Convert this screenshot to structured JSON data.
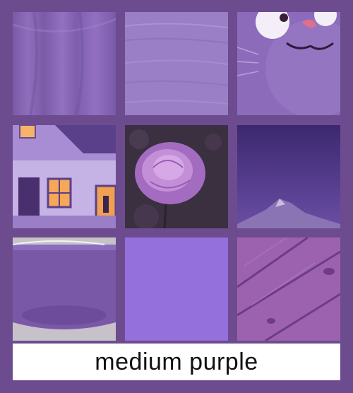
{
  "caption": {
    "text": "medium purple"
  },
  "tiles": [
    {
      "name": "draped-fabric",
      "icon": "fabric-swatch"
    },
    {
      "name": "brushed-paint",
      "icon": "paint-swatch"
    },
    {
      "name": "cartoon-cat",
      "icon": "cat-illustration"
    },
    {
      "name": "cottage-house",
      "icon": "house-illustration"
    },
    {
      "name": "peony-flower",
      "icon": "flower-photo"
    },
    {
      "name": "mountain-sky",
      "icon": "mountain-landscape"
    },
    {
      "name": "ceramic-bowl",
      "icon": "bowl-photo"
    },
    {
      "name": "flat-swatch",
      "icon": "solid-color-swatch"
    },
    {
      "name": "wood-planks",
      "icon": "wood-texture"
    }
  ],
  "colors": {
    "background": "#6c4c8f",
    "swatch": "#9370db"
  }
}
